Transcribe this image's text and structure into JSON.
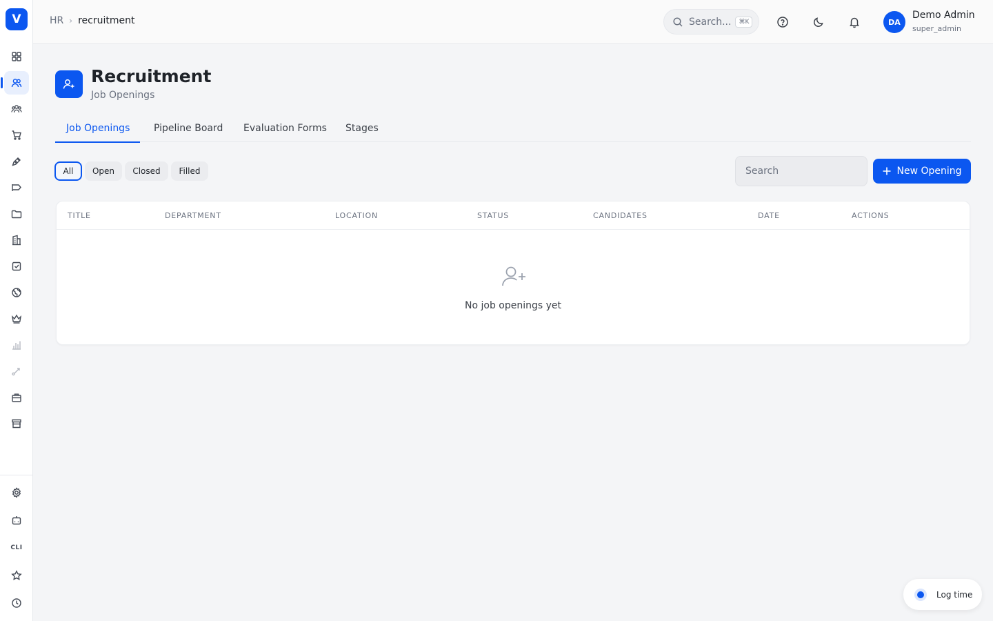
{
  "app": {
    "logo_letter": "V"
  },
  "breadcrumb": {
    "parent": "HR",
    "current": "recruitment"
  },
  "header": {
    "search_placeholder": "Search...",
    "search_shortcut": "⌘K",
    "user": {
      "initials": "DA",
      "name": "Demo Admin",
      "role": "super_admin"
    }
  },
  "sidebar": {
    "items": [
      {
        "icon": "grid-icon"
      },
      {
        "icon": "users-icon",
        "active": true
      },
      {
        "icon": "team-icon"
      },
      {
        "icon": "cart-icon"
      },
      {
        "icon": "pen-icon"
      },
      {
        "icon": "megaphone-icon"
      },
      {
        "icon": "folder-icon"
      },
      {
        "icon": "building-icon"
      },
      {
        "icon": "checkbox-icon"
      },
      {
        "icon": "globe-icon"
      },
      {
        "icon": "crown-icon"
      },
      {
        "icon": "bar-chart-icon"
      },
      {
        "icon": "route-icon"
      },
      {
        "icon": "briefcase-icon"
      },
      {
        "icon": "store-icon"
      }
    ],
    "bottom_items": [
      {
        "icon": "gear-icon"
      },
      {
        "icon": "bot-icon"
      },
      {
        "label": "CLI"
      },
      {
        "icon": "star-icon"
      },
      {
        "icon": "clock-icon"
      }
    ]
  },
  "page": {
    "title": "Recruitment",
    "subtitle": "Job Openings"
  },
  "tabs": [
    {
      "label": "Job Openings",
      "active": true
    },
    {
      "label": "Pipeline Board"
    },
    {
      "label": "Evaluation Forms"
    },
    {
      "label": "Stages"
    }
  ],
  "filters": [
    {
      "label": "All",
      "active": true
    },
    {
      "label": "Open"
    },
    {
      "label": "Closed"
    },
    {
      "label": "Filled"
    }
  ],
  "list": {
    "search_placeholder": "Search",
    "new_button": "New Opening",
    "columns": [
      "TITLE",
      "DEPARTMENT",
      "LOCATION",
      "STATUS",
      "CANDIDATES",
      "DATE",
      "ACTIONS"
    ],
    "rows": [],
    "empty_text": "No job openings yet"
  },
  "log_time": {
    "label": "Log time"
  },
  "colors": {
    "accent": "#0b57f0",
    "background": "#f4f5f7"
  }
}
